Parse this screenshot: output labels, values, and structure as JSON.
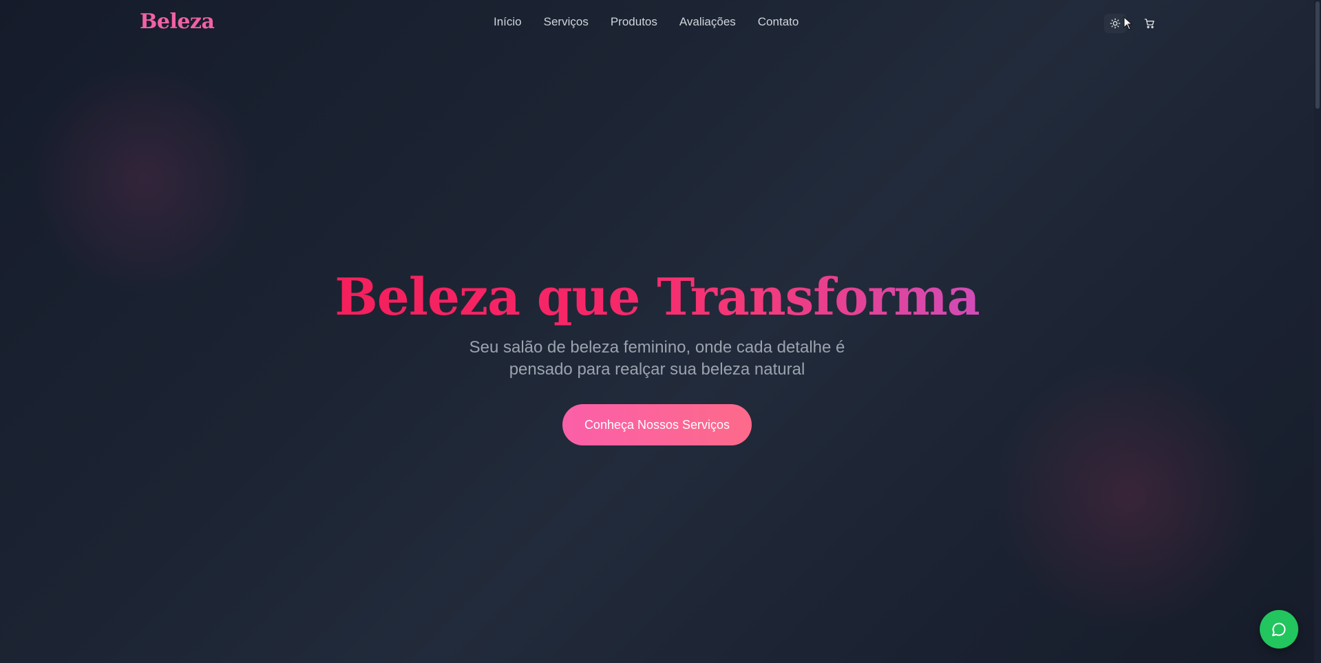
{
  "header": {
    "logo": "Beleza",
    "nav": [
      {
        "label": "Início"
      },
      {
        "label": "Serviços"
      },
      {
        "label": "Produtos"
      },
      {
        "label": "Avaliações"
      },
      {
        "label": "Contato"
      }
    ],
    "icons": {
      "theme": "sun-icon",
      "cart": "cart-icon"
    }
  },
  "hero": {
    "title": "Beleza que Transforma",
    "subtitle_line1": "Seu salão de beleza feminino, onde cada detalhe é",
    "subtitle_line2": "pensado para realçar sua beleza natural",
    "cta": "Conheça Nossos Serviços"
  },
  "floating": {
    "icon": "chat-bubble-icon",
    "color": "#22c55e"
  },
  "colors": {
    "accent": "#f062a3",
    "title_gradient_start": "#f51f5c",
    "title_gradient_end": "#d14cb8"
  }
}
